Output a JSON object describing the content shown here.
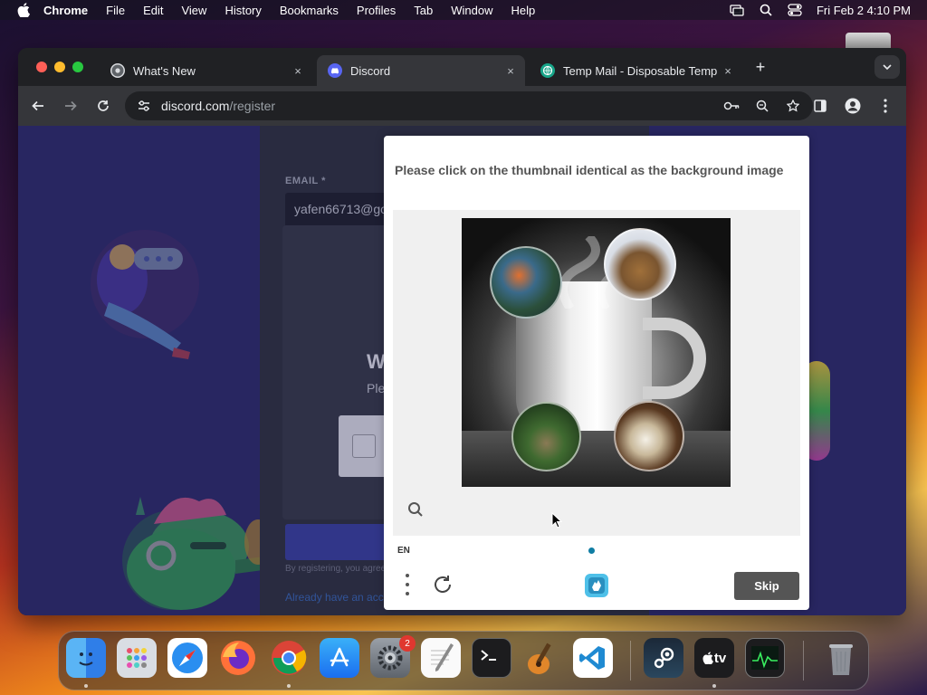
{
  "menubar": {
    "app": "Chrome",
    "items": [
      "File",
      "Edit",
      "View",
      "History",
      "Bookmarks",
      "Profiles",
      "Tab",
      "Window",
      "Help"
    ],
    "clock": "Fri Feb 2  4:10 PM"
  },
  "tabs": [
    {
      "title": "What's New",
      "close": "×"
    },
    {
      "title": "Discord",
      "close": "×"
    },
    {
      "title": "Temp Mail - Disposable Temp",
      "close": "×"
    }
  ],
  "new_tab": "+",
  "address": {
    "host": "discord.com",
    "path": "/register"
  },
  "discord": {
    "email_label": "EMAIL *",
    "email_value": "yafen66713@gos",
    "heading_partial": "W",
    "sub_partial": "Ple",
    "fine_print": "By registering, you agree",
    "login_link": "Already have an acc"
  },
  "captcha": {
    "prompt": "Please click on the thumbnail identical as the background image",
    "language": "EN",
    "skip_label": "Skip"
  },
  "dock": {
    "apps": [
      "finder",
      "launchpad",
      "safari",
      "firefox",
      "chrome",
      "app-store",
      "system-settings",
      "textedit",
      "terminal",
      "garageband",
      "vscode",
      "steam",
      "apple-tv",
      "activity-monitor",
      "trash"
    ],
    "settings_badge": "2",
    "tv_label": "tv"
  },
  "colors": {
    "discord_blurple": "#5865f2",
    "captcha_skip": "#555555",
    "captcha_dot": "#0f7da3"
  }
}
